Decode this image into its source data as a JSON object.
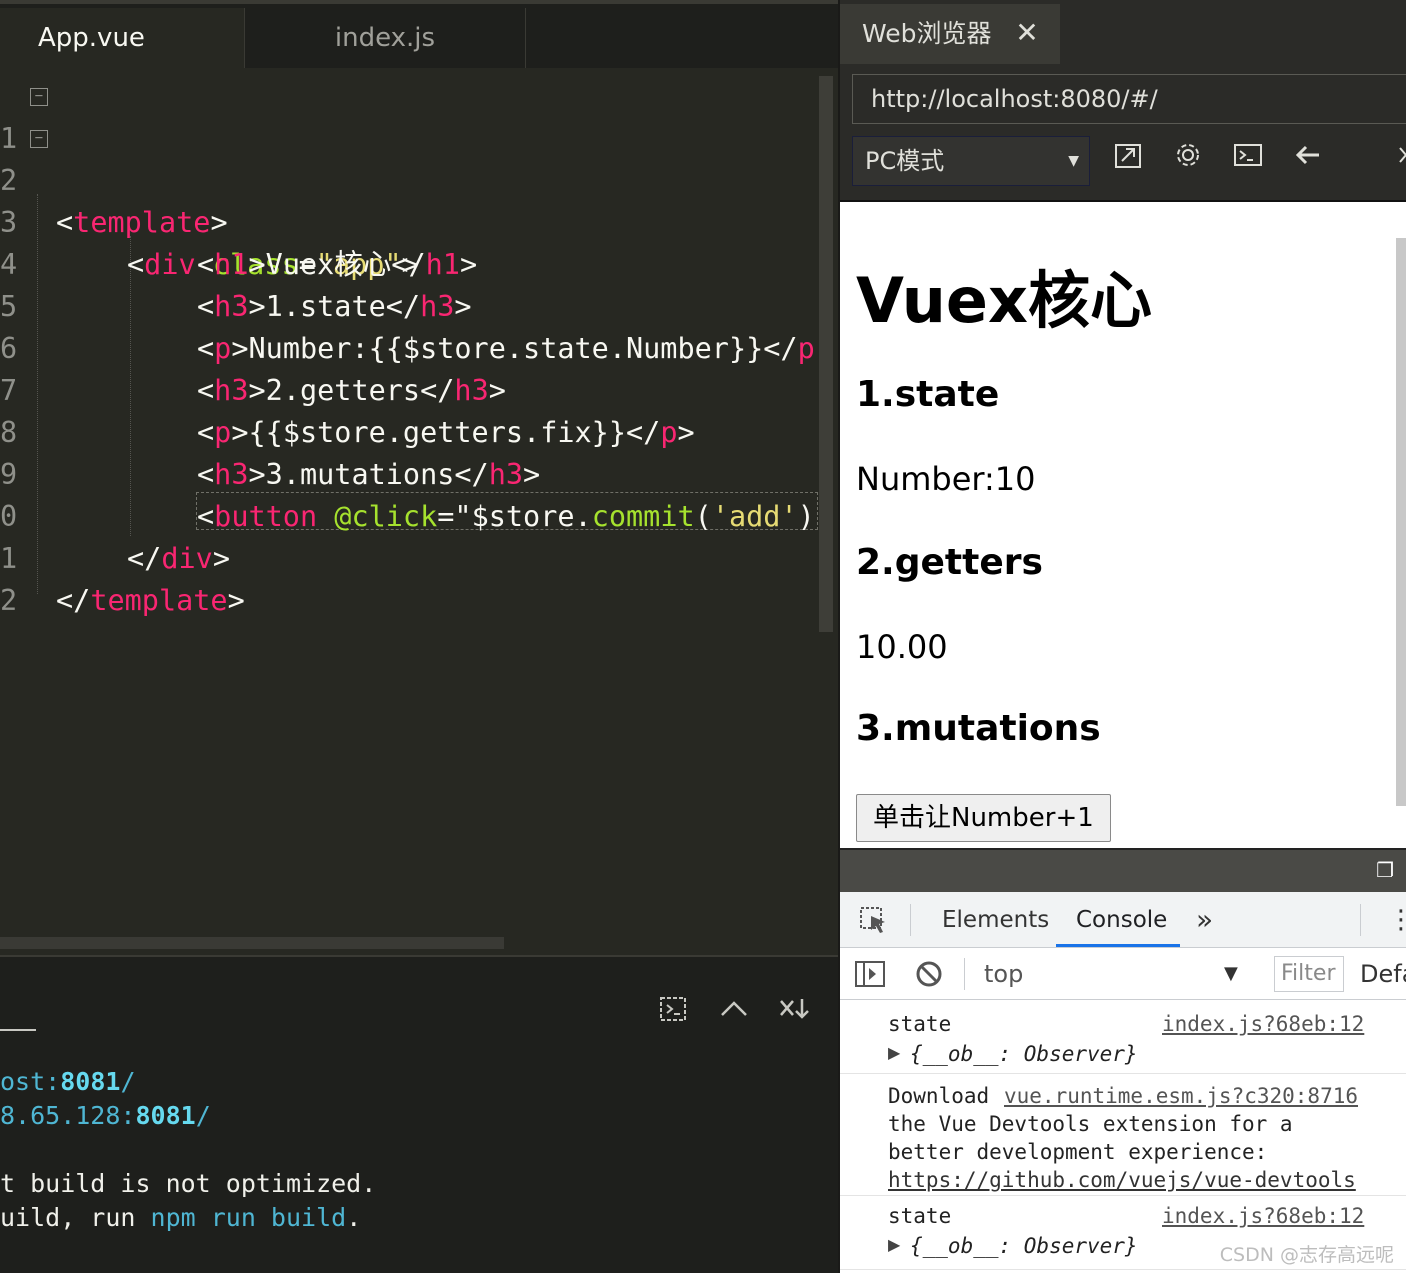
{
  "editor": {
    "tabs": [
      {
        "label": "App.vue",
        "active": true
      },
      {
        "label": "index.js",
        "active": false
      }
    ],
    "fold_marker": "−",
    "lines": [
      {
        "num": "1",
        "tokens": [
          "<",
          "template",
          ">"
        ]
      },
      {
        "num": "2",
        "tokens": [
          "<",
          "div",
          " ",
          "class",
          "=",
          "\"app\"",
          ">"
        ]
      },
      {
        "num": "3",
        "tokens": [
          "<",
          "h1",
          ">Vuex核心</",
          "h1",
          ">"
        ]
      },
      {
        "num": "4",
        "tokens": [
          "<",
          "h3",
          ">1.state</",
          "h3",
          ">"
        ]
      },
      {
        "num": "5",
        "tokens": [
          "<",
          "p",
          ">Number:{{$store.state.Number}}</",
          "p"
        ]
      },
      {
        "num": "6",
        "tokens": [
          "<",
          "h3",
          ">2.getters</",
          "h3",
          ">"
        ]
      },
      {
        "num": "7",
        "tokens": [
          "<",
          "p",
          ">{{$store.getters.fix}}</",
          "p",
          ">"
        ]
      },
      {
        "num": "8",
        "tokens": [
          "<",
          "h3",
          ">3.mutations</",
          "h3",
          ">"
        ]
      },
      {
        "num": "9",
        "tokens": [
          "<",
          "button",
          " ",
          "@click",
          "=\"$store.",
          "commit",
          "(",
          "'add'",
          ")"
        ]
      },
      {
        "num": "0",
        "tokens": [
          "</",
          "div",
          ">"
        ]
      },
      {
        "num": "1",
        "tokens": [
          "</",
          "template",
          ">"
        ]
      },
      {
        "num": "2",
        "tokens": []
      }
    ]
  },
  "terminal": {
    "icons": [
      "clear-terminal-icon",
      "chevron-up-icon",
      "close-panel-icon"
    ],
    "lines": [
      [
        {
          "text": "ost:",
          "c": "cy"
        },
        {
          "text": "8081",
          "c": "cyb"
        },
        {
          "text": "/",
          "c": "cy"
        }
      ],
      [
        {
          "text": "8.65.128:",
          "c": "cy"
        },
        {
          "text": "8081",
          "c": "cyb"
        },
        {
          "text": "/",
          "c": "cy"
        }
      ],
      [],
      [
        {
          "text": "t build is not optimized.",
          "c": ""
        }
      ],
      [
        {
          "text": "uild, run ",
          "c": ""
        },
        {
          "text": "npm run build",
          "c": "cy"
        },
        {
          "text": ".",
          "c": ""
        }
      ]
    ]
  },
  "browser": {
    "tab_label": "Web浏览器",
    "close_glyph": "✕",
    "url": "http://localhost:8080/#/",
    "mode": "PC模式",
    "page": {
      "h1": "Vuex核心",
      "sections": [
        {
          "heading": "1.state",
          "text": "Number:10"
        },
        {
          "heading": "2.getters",
          "text": "10.00"
        },
        {
          "heading": "3.mutations",
          "text": ""
        }
      ],
      "button": "单击让Number+1"
    }
  },
  "devtools": {
    "tabs": [
      "Elements",
      "Console"
    ],
    "active_tab": "Console",
    "more": "»",
    "context": "top",
    "filter_placeholder": "Filter",
    "levels": "Defa",
    "messages": [
      {
        "text": "state",
        "source": "index.js?68eb:12",
        "object": "{__ob__: Observer}"
      },
      {
        "text_lines": [
          "Download",
          "the Vue Devtools extension for a",
          "better development experience:"
        ],
        "source": "vue.runtime.esm.js?c320:8716",
        "link": "https://github.com/vuejs/vue-devtools"
      },
      {
        "text": "state",
        "source": "index.js?68eb:12",
        "object": "{__ob__: Observer}"
      }
    ]
  },
  "watermark": "CSDN @志存高远呢",
  "colors": {
    "editor_bg": "#272822",
    "tag": "#f92672",
    "attr": "#a6e22e",
    "string": "#e6db74",
    "devtools_accent": "#1a73e8"
  }
}
